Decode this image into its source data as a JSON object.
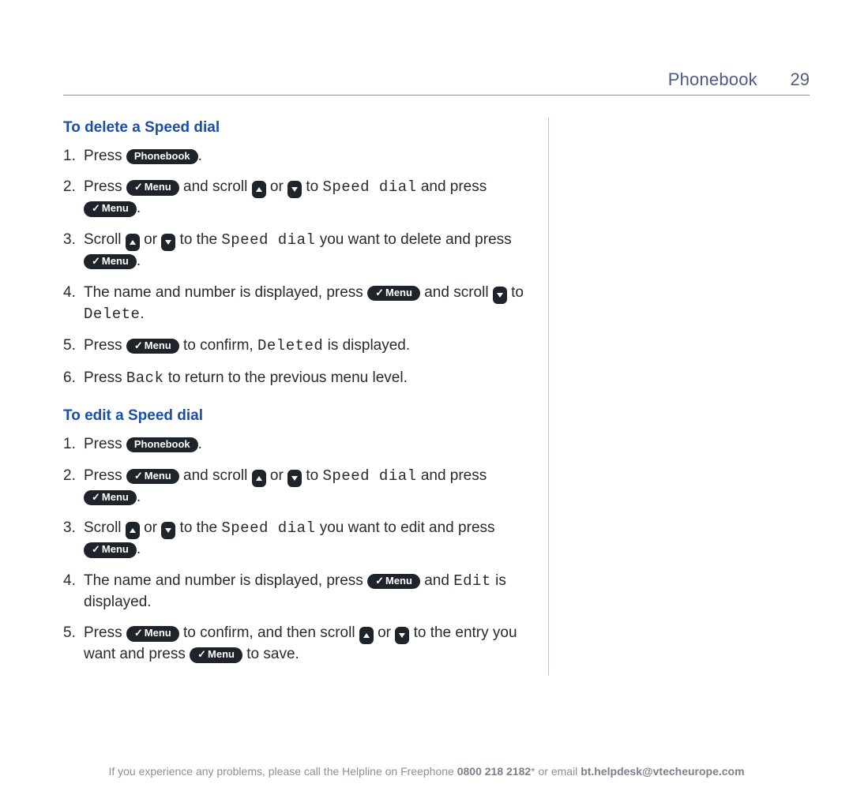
{
  "header": {
    "section": "Phonebook",
    "page": "29"
  },
  "buttons": {
    "phonebook": "Phonebook",
    "menu": "Menu"
  },
  "lcd": {
    "speed_dial": "Speed dial",
    "delete": "Delete",
    "deleted": "Deleted",
    "back": "Back",
    "edit": "Edit"
  },
  "words": {
    "press": "Press",
    "scroll": "Scroll",
    "and_scroll": "and scroll",
    "or": "or",
    "to": "to",
    "and_press": "and press",
    "to_the": "to the",
    "you_want_delete_and": "you want to delete and",
    "you_want_edit_and": "you want to edit and",
    "press_lower": "press",
    "name_number_displayed_press": "The name and number is displayed, press",
    "to_confirm": "to confirm,",
    "is_displayed": "is displayed.",
    "press_back_return": "to return to the previous menu level.",
    "and": "and",
    "to_confirm_then_scroll": "to confirm, and then scroll",
    "to_entry_you_want_press": "to the entry you want and press",
    "to_save": "to save."
  },
  "sections": {
    "delete": {
      "title": "To delete a Speed dial"
    },
    "edit": {
      "title": "To edit a Speed dial"
    }
  },
  "footer": {
    "pre": "If you experience any problems, please call the Helpline on Freephone ",
    "phone": "0800 218 2182",
    "mid": "* or email ",
    "email": "bt.helpdesk@vtecheurope.com"
  }
}
